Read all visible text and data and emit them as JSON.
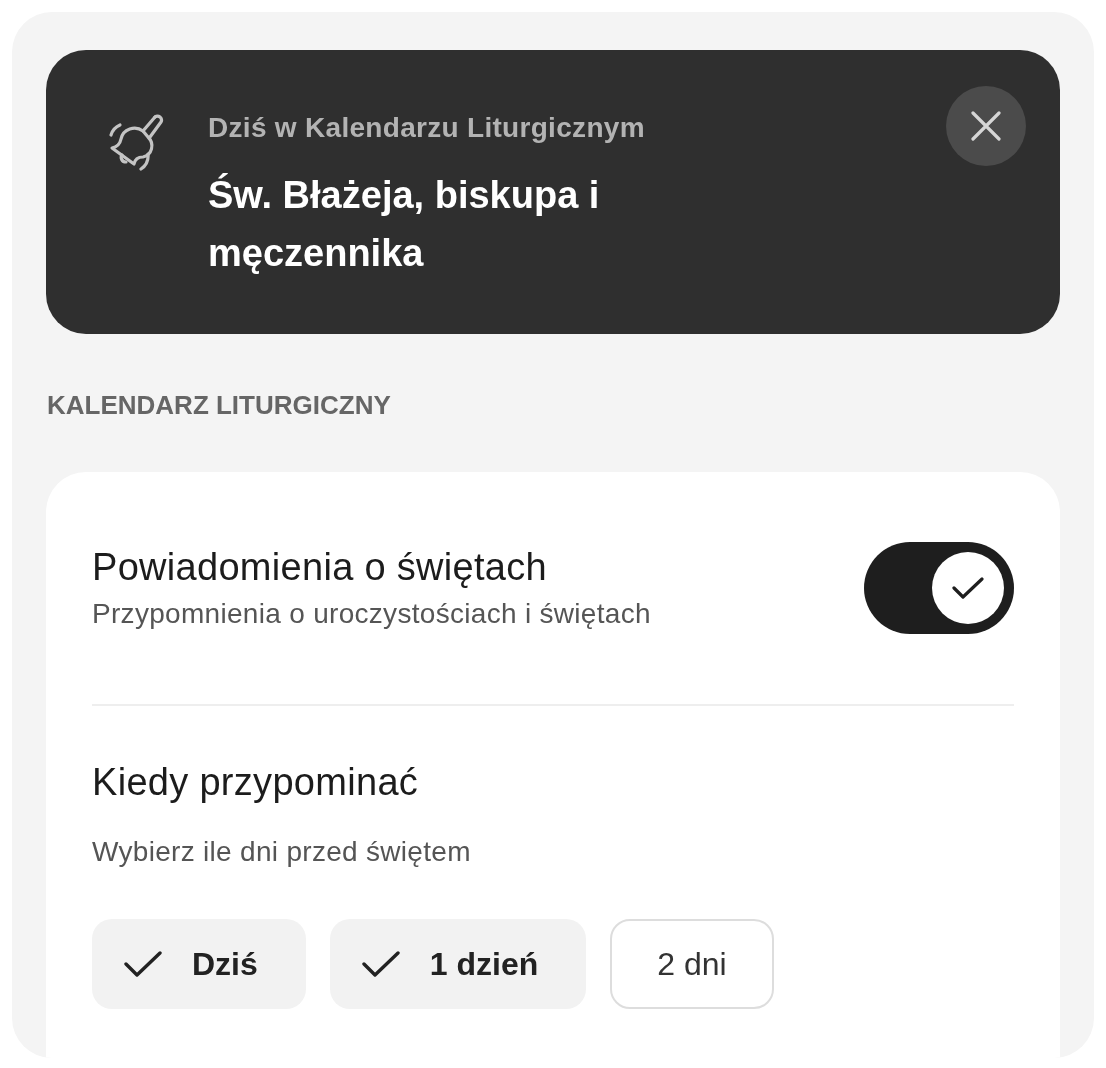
{
  "banner": {
    "overline": "Dziś w Kalendarzu Liturgicznym",
    "title": "Św. Błażeja, biskupa i męczennika"
  },
  "section": {
    "heading": "KALENDARZ LITURGICZNY"
  },
  "settings": {
    "toggle_row": {
      "title": "Powiadomienia o świętach",
      "subtitle": "Przypomnienia o uroczystościach i świętach",
      "on": true
    },
    "reminder": {
      "title": "Kiedy przypominać",
      "subtitle": "Wybierz ile dni przed świętem",
      "options": [
        {
          "label": "Dziś",
          "selected": true
        },
        {
          "label": "1 dzień",
          "selected": true
        },
        {
          "label": "2 dni",
          "selected": false
        }
      ]
    }
  }
}
